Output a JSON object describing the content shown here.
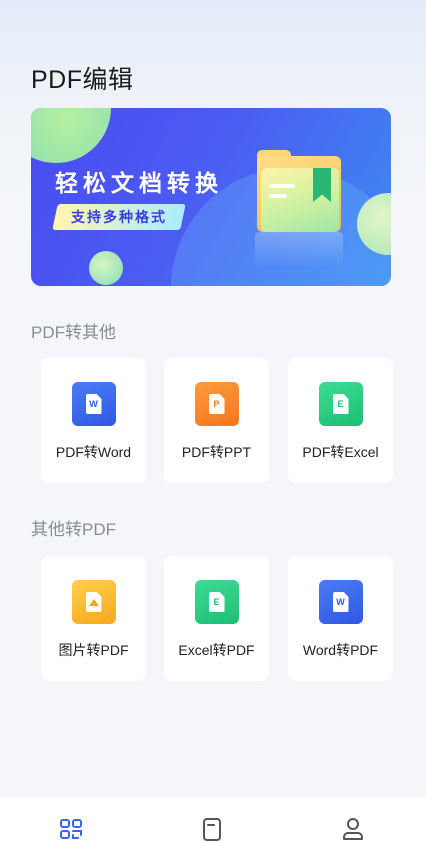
{
  "header": {
    "title": "PDF编辑"
  },
  "banner": {
    "headline": "轻松文档转换",
    "tagline": "支持多种格式"
  },
  "sections": [
    {
      "title": "PDF转其他",
      "items": [
        {
          "label": "PDF转Word",
          "icon": "word-doc-icon",
          "badge": "W",
          "color": "#2f58e3"
        },
        {
          "label": "PDF转PPT",
          "icon": "ppt-doc-icon",
          "badge": "P",
          "color": "#f3761e"
        },
        {
          "label": "PDF转Excel",
          "icon": "excel-doc-icon",
          "badge": "E",
          "color": "#1dbf73"
        }
      ]
    },
    {
      "title": "其他转PDF",
      "items": [
        {
          "label": "图片转PDF",
          "icon": "image-doc-icon",
          "badge": "",
          "color": "#f6a81e"
        },
        {
          "label": "Excel转PDF",
          "icon": "excel-doc-icon",
          "badge": "E",
          "color": "#1dbf73"
        },
        {
          "label": "Word转PDF",
          "icon": "word-doc-icon",
          "badge": "W",
          "color": "#2f58e3"
        }
      ]
    }
  ],
  "bottom_nav": {
    "items": [
      {
        "icon": "tools-grid-icon",
        "active": true,
        "color": "#3b64f0"
      },
      {
        "icon": "document-icon",
        "active": false,
        "color": "#555555"
      },
      {
        "icon": "profile-icon",
        "active": false,
        "color": "#555555"
      }
    ]
  }
}
